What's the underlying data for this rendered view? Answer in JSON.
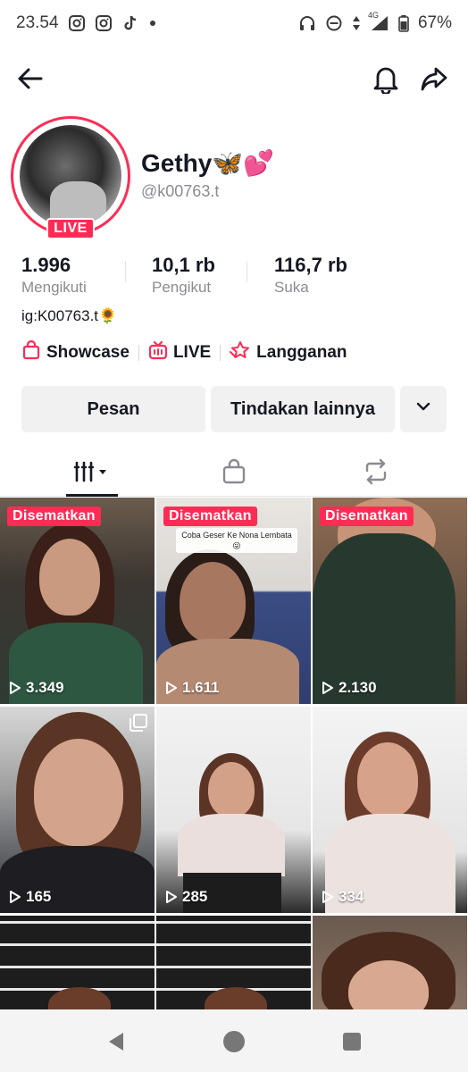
{
  "status_bar": {
    "time": "23.54",
    "network": "4G",
    "battery": "67%",
    "left_icons": [
      "instagram-icon",
      "instagram-icon",
      "tiktok-icon",
      "dot-icon"
    ],
    "right_icons": [
      "headphones-icon",
      "dnd-icon",
      "data-arrows-icon",
      "signal-icon",
      "battery-icon"
    ]
  },
  "nav": {
    "back_icon": "back-arrow-icon",
    "bell_icon": "bell-icon",
    "share_icon": "share-icon"
  },
  "profile": {
    "name": "Gethy🦋💕",
    "username": "@k00763.t",
    "live_badge": "LIVE",
    "bio": "ig:K00763.t🌻"
  },
  "stats": [
    {
      "value": "1.996",
      "label": "Mengikuti"
    },
    {
      "value": "10,1 rb",
      "label": "Pengikut"
    },
    {
      "value": "116,7 rb",
      "label": "Suka"
    }
  ],
  "links": [
    {
      "label": "Showcase",
      "icon": "shopping-bag-icon"
    },
    {
      "label": "LIVE",
      "icon": "live-tv-icon"
    },
    {
      "label": "Langganan",
      "icon": "subscription-star-icon"
    }
  ],
  "actions": {
    "message": "Pesan",
    "more_actions": "Tindakan lainnya",
    "dropdown_icon": "chevron-down-icon"
  },
  "tabs": [
    {
      "icon": "video-grid-icon",
      "active": true
    },
    {
      "icon": "shopping-bag-icon",
      "active": false
    },
    {
      "icon": "repost-icon",
      "active": false
    }
  ],
  "videos": [
    {
      "pinned": "Disematkan",
      "views": "3.349"
    },
    {
      "pinned": "Disematkan",
      "views": "1.611",
      "caption": "Coba Geser Ke Nona Lembata😜"
    },
    {
      "pinned": "Disematkan",
      "views": "2.130"
    },
    {
      "views": "165",
      "multi": true
    },
    {
      "views": "285"
    },
    {
      "views": "334"
    },
    {},
    {},
    {}
  ],
  "colors": {
    "accent": "#fe2c55",
    "text": "#161823",
    "muted": "#8a8b91"
  }
}
